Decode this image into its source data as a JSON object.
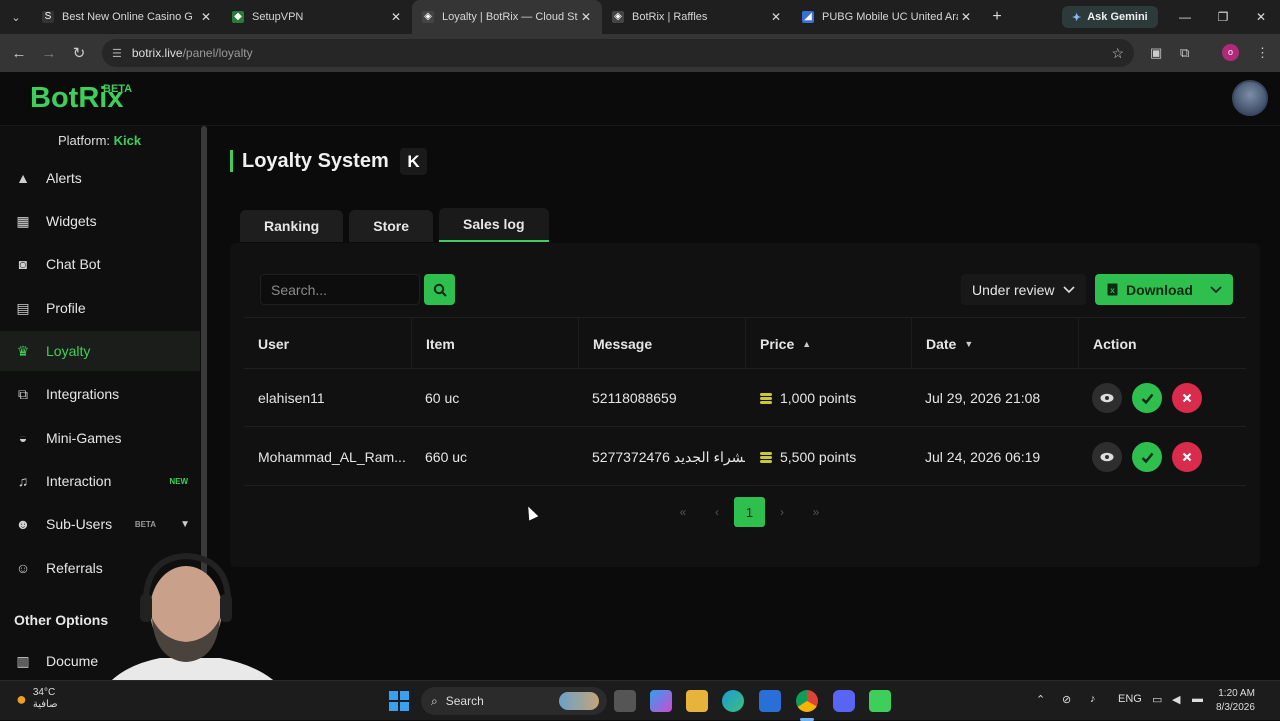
{
  "browser": {
    "tabs": [
      {
        "title": "Best New Online Casino G",
        "favicon": "S",
        "favicon_color": "#333333"
      },
      {
        "title": "SetupVPN",
        "favicon": "vpn-icon",
        "favicon_color": "#2a7a3a"
      },
      {
        "title": "Loyalty | BotRix — Cloud Strea",
        "favicon": "botrix-icon",
        "favicon_color": "#1a1a1a",
        "active": true
      },
      {
        "title": "BotRix | Raffles",
        "favicon": "botrix-icon",
        "favicon_color": "#1a1a1a"
      },
      {
        "title": "PUBG Mobile UC United Arab",
        "favicon": "pubg-icon",
        "favicon_color": "#3a6fd8"
      }
    ],
    "gemini_label": "Ask Gemini",
    "url_host": "botrix.live",
    "url_path": "/panel/loyalty",
    "profile_initial": "o"
  },
  "app": {
    "logo": "BotRix",
    "logo_badge": "BETA",
    "platform_label": "Platform:",
    "platform_value": "Kick"
  },
  "sidebar": {
    "items": [
      {
        "label": "Alerts",
        "icon": "warning-icon"
      },
      {
        "label": "Widgets",
        "icon": "grid-icon"
      },
      {
        "label": "Chat Bot",
        "icon": "robot-icon"
      },
      {
        "label": "Profile",
        "icon": "id-card-icon"
      },
      {
        "label": "Loyalty",
        "icon": "trophy-icon",
        "active": true
      },
      {
        "label": "Integrations",
        "icon": "puzzle-icon"
      },
      {
        "label": "Mini-Games",
        "icon": "gamepad-icon"
      },
      {
        "label": "Interaction",
        "icon": "music-icon",
        "badge": "NEW"
      },
      {
        "label": "Sub-Users",
        "icon": "users-icon",
        "badge": "BETA"
      },
      {
        "label": "Referrals",
        "icon": "people-icon"
      }
    ],
    "other_options": "Other Options",
    "doc_item": "Docume"
  },
  "page": {
    "title": "Loyalty System",
    "platform_badge": "K",
    "tabs": [
      "Ranking",
      "Store",
      "Sales log"
    ],
    "active_tab": "Sales log",
    "search_placeholder": "Search...",
    "filter_value": "Under review",
    "download_label": "Download"
  },
  "table": {
    "columns": [
      "User",
      "Item",
      "Message",
      "Price",
      "Date",
      "Action"
    ],
    "rows": [
      {
        "user": "elahisen11",
        "item": "60 uc",
        "message": "52118088659",
        "price": "1,000 points",
        "date": "Jul 29, 2026 21:08"
      },
      {
        "user": "Mohammad_AL_Ram...",
        "item": "660 uc",
        "message": "5277372476 لشراء الجديد...",
        "price": "5,500 points",
        "date": "Jul 24, 2026 06:19"
      }
    ]
  },
  "pagination": {
    "current": "1"
  },
  "taskbar": {
    "temperature": "34°C",
    "weather_text": "صافية",
    "search_label": "Search",
    "lang": "ENG",
    "time": "1:20 AM",
    "date": "8/3/2026"
  },
  "colors": {
    "accent": "#3ecf5a",
    "danger": "#d92b4b",
    "background": "#0b0b0b"
  }
}
